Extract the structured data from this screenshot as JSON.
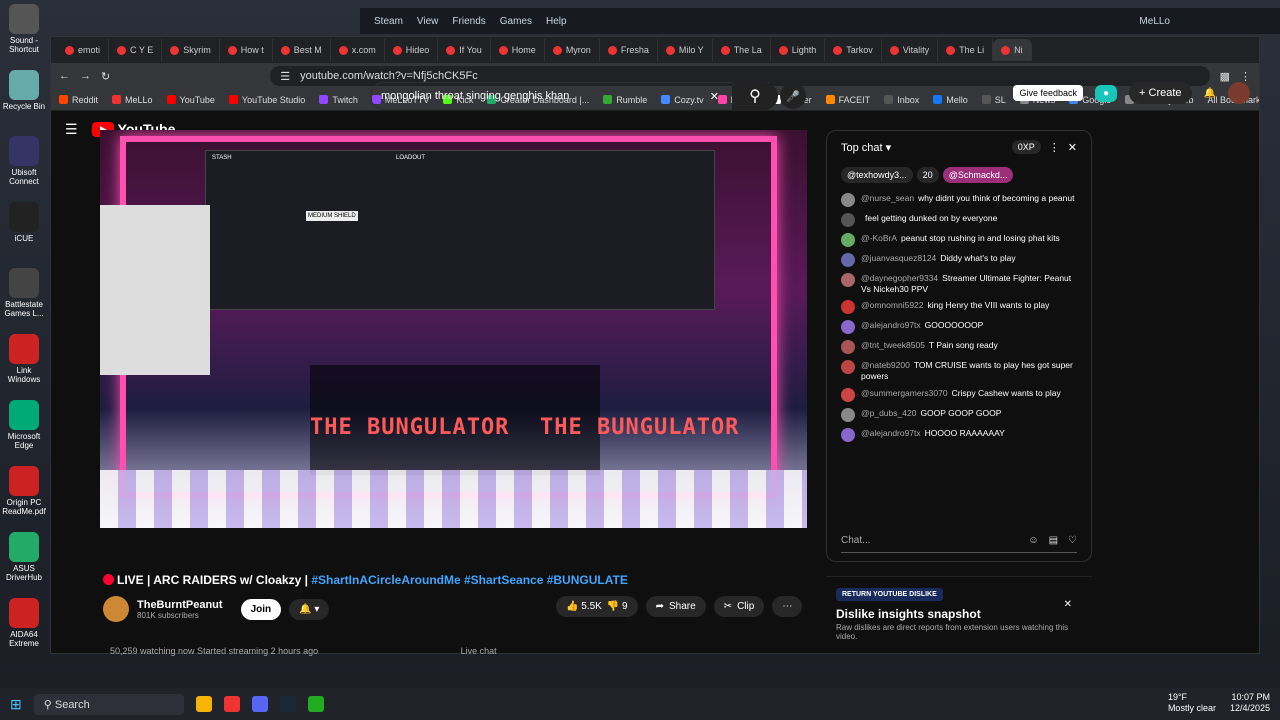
{
  "desktop": {
    "icons": [
      {
        "label": "Sound - Shortcut",
        "color": "#555"
      },
      {
        "label": "Recycle Bin",
        "color": "#6aa"
      },
      {
        "label": "Ubisoft Connect",
        "color": "#336"
      },
      {
        "label": "iCUE",
        "color": "#222"
      },
      {
        "label": "Battlestate Games L...",
        "color": "#444"
      },
      {
        "label": "Link Windows",
        "color": "#c22"
      },
      {
        "label": "Microsoft Edge",
        "color": "#0a7"
      },
      {
        "label": "Origin PC ReadMe.pdf",
        "color": "#c22"
      },
      {
        "label": "ASUS DriverHub",
        "color": "#2a6"
      },
      {
        "label": "AIDA64 Extreme",
        "color": "#c22"
      }
    ]
  },
  "steam": {
    "title": "Steam",
    "menu": [
      "View",
      "Friends",
      "Games",
      "Help"
    ],
    "user": "MeLLo"
  },
  "browser": {
    "tabs": [
      "emoti",
      "C Y E",
      "Skyrim",
      "How t",
      "Best M",
      "x.com",
      "Hideo",
      "If You",
      "Home",
      "Myron",
      "Fresha",
      "Milo Y",
      "The La",
      "Lighth",
      "Tarkov",
      "Vitality",
      "The Li",
      "Ni"
    ],
    "url": "youtube.com/watch?v=Nfj5chCK5Fc",
    "bookmarks": [
      "Reddit",
      "MeLLo",
      "YouTube",
      "YouTube Studio",
      "Twitch",
      "MeLLoTTV",
      "Kick",
      "Creator Dashboard |...",
      "Rumble",
      "Cozy.tv",
      "MeLLo",
      "Twitter",
      "FACEIT",
      "Inbox",
      "Mello",
      "SL",
      "News",
      "Google",
      "Woolbity Web"
    ],
    "all_bookmarks": "All Bookmarks"
  },
  "youtube": {
    "logo": "YouTube",
    "search_value": "mongolian throat singing genghis khan",
    "feedback": "Give feedback",
    "create": "Create"
  },
  "video": {
    "overlay_left": "THE BUNGULATOR",
    "overlay_right": "THE BUNGULATOR",
    "stash": "STASH",
    "loadout": "LOADOUT",
    "item": "MEDIUM SHIELD",
    "title_prefix": "LIVE | ARC RAIDERS w/ Cloakzy | ",
    "hashtags": "#ShartInACircleAroundMe #ShartSeance #BUNGULATE",
    "channel": "TheBurntPeanut",
    "subs": "801K subscribers",
    "join": "Join",
    "likes": "5.5K",
    "dislikes": "9",
    "share": "Share",
    "clip": "Clip",
    "watching": "50,259 watching now  Started streaming 2 hours ago",
    "live_chat_tab": "Live chat"
  },
  "chat": {
    "header": "Top chat",
    "xp": "0XP",
    "pins": [
      "@texhowdy3...",
      "20",
      "@Schmackd..."
    ],
    "messages": [
      {
        "author": "@nurse_sean",
        "text": "why didnt you think of becoming a peanut",
        "color": "#888"
      },
      {
        "author": "",
        "text": "feel getting dunked on by everyone",
        "color": "#555"
      },
      {
        "author": "@-KoBrA",
        "text": "peanut stop rushing in and losing phat kits",
        "color": "#6a6"
      },
      {
        "author": "@juanvasquez8124",
        "text": "Diddy what's to play",
        "color": "#66a"
      },
      {
        "author": "@daynegopher9334",
        "text": "Streamer Ultimate Fighter: Peanut Vs Nickeh30 PPV",
        "color": "#a66"
      },
      {
        "author": "@omnomni5922",
        "text": "king Henry the VIII wants to play",
        "color": "#c33"
      },
      {
        "author": "@alejandro97tx",
        "text": "GOOOOOOOP",
        "color": "#86c"
      },
      {
        "author": "@tnt_tweek8505",
        "text": "T Pain song ready",
        "color": "#a55"
      },
      {
        "author": "@nateb9200",
        "text": "TOM CRUISE wants to play hes got super powers",
        "color": "#b44"
      },
      {
        "author": "@summergamers3070",
        "text": "Crispy Cashew wants to play",
        "color": "#c44"
      },
      {
        "author": "@p_dubs_420",
        "text": "GOOP GOOP GOOP",
        "color": "#888"
      },
      {
        "author": "@alejandro97tx",
        "text": "HOOOO RAAAAAAY",
        "color": "#86c"
      }
    ],
    "input_placeholder": "Chat..."
  },
  "dislike_panel": {
    "tag": "RETURN YOUTUBE DISLIKE",
    "title": "Dislike insights snapshot",
    "sub": "Raw dislikes are direct reports from extension users watching this video."
  },
  "taskbar": {
    "search": "Search",
    "weather_temp": "19°F",
    "weather_desc": "Mostly clear",
    "time": "10:07 PM",
    "date": "12/4/2025"
  }
}
